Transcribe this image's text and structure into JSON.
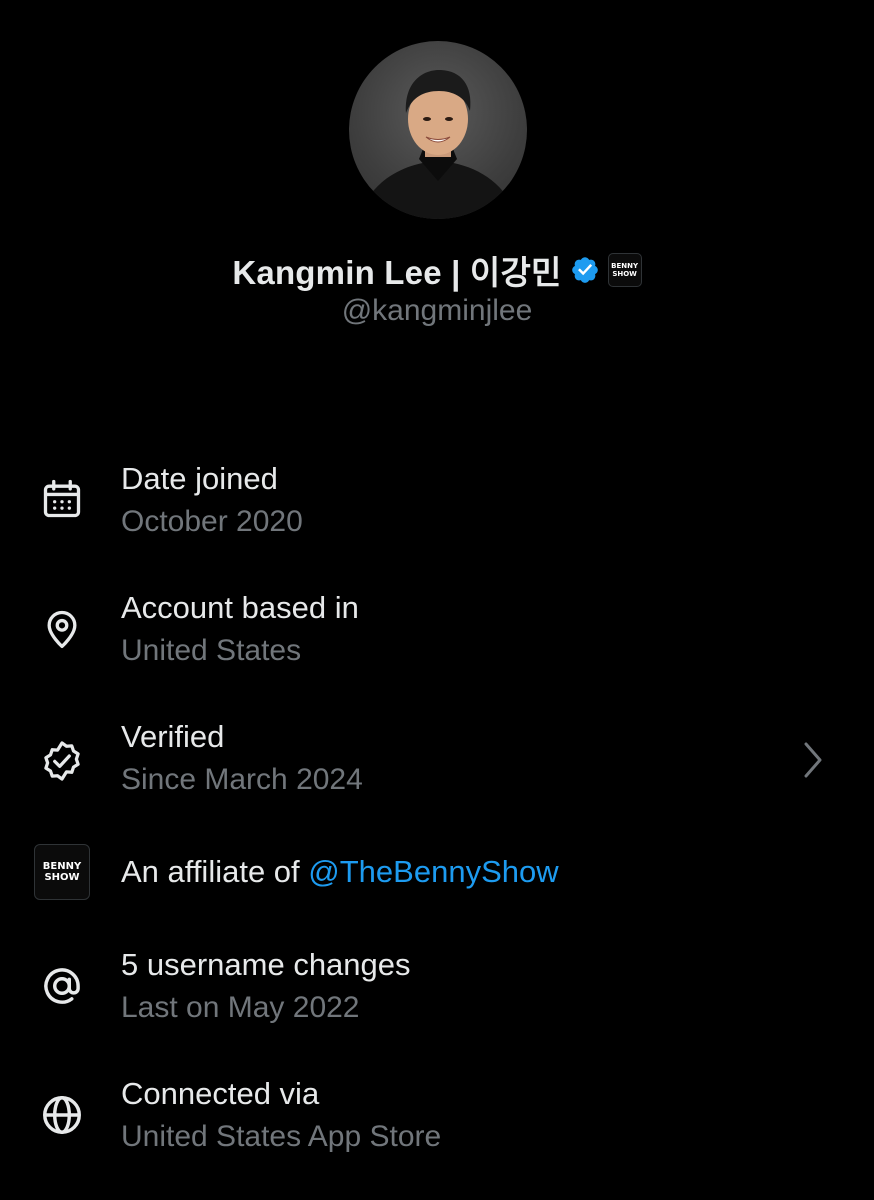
{
  "profile": {
    "display_name": "Kangmin Lee | 이강민",
    "handle": "@kangminjlee",
    "verified_icon": "verified-badge-icon",
    "affiliate_badge_lines": [
      "BENNY",
      "SHOW"
    ]
  },
  "colors": {
    "background": "#000000",
    "primary_text": "#e7e9ea",
    "secondary_text": "#71767b",
    "link": "#1d9bf0",
    "verified_blue": "#1d9bf0"
  },
  "rows": {
    "date_joined": {
      "icon": "calendar-icon",
      "title": "Date joined",
      "subtitle": "October 2020"
    },
    "account_based": {
      "icon": "location-pin-icon",
      "title": "Account based in",
      "subtitle": "United States"
    },
    "verified": {
      "icon": "verified-badge-outline-icon",
      "title": "Verified",
      "subtitle": "Since March 2024",
      "chevron": "chevron-right-icon"
    },
    "affiliate": {
      "icon": "affiliate-badge-icon",
      "title_prefix": "An affiliate of ",
      "link_text": "@TheBennyShow",
      "badge_lines": [
        "BENNY",
        "SHOW"
      ]
    },
    "username_changes": {
      "icon": "at-sign-icon",
      "title": "5 username changes",
      "subtitle": "Last on May 2022"
    },
    "connected_via": {
      "icon": "globe-icon",
      "title": "Connected via",
      "subtitle": "United States App Store"
    }
  }
}
